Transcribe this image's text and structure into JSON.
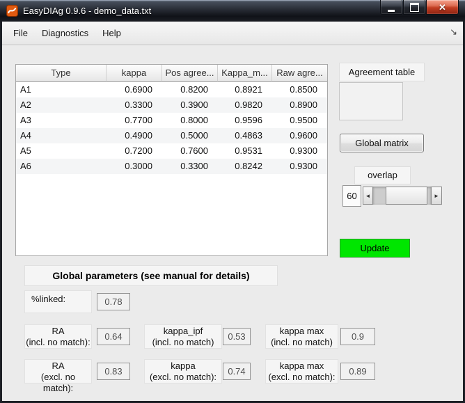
{
  "window": {
    "title": "EasyDIAg 0.9.6 - demo_data.txt"
  },
  "menu": {
    "items": [
      "File",
      "Diagnostics",
      "Help"
    ]
  },
  "icons": {
    "app": "matlab-logo",
    "minimize": "minimize-bar",
    "maximize": "restore-box",
    "close": "✕",
    "menubar_dock": "↘",
    "slider_left": "◄",
    "slider_right": "►"
  },
  "table": {
    "columns": [
      "Type",
      "kappa",
      "Pos agree...",
      "Kappa_m...",
      "Raw agre..."
    ],
    "rows": [
      [
        "A1",
        "0.6900",
        "0.8200",
        "0.8921",
        "0.8500"
      ],
      [
        "A2",
        "0.3300",
        "0.3900",
        "0.9820",
        "0.8900"
      ],
      [
        "A3",
        "0.7700",
        "0.8000",
        "0.9596",
        "0.9500"
      ],
      [
        "A4",
        "0.4900",
        "0.5000",
        "0.4863",
        "0.9600"
      ],
      [
        "A5",
        "0.7200",
        "0.7600",
        "0.9531",
        "0.9300"
      ],
      [
        "A6",
        "0.3000",
        "0.3300",
        "0.8242",
        "0.9300"
      ]
    ]
  },
  "side": {
    "agreement_table_label": "Agreement table",
    "global_matrix_label": "Global matrix",
    "overlap_label": "overlap",
    "overlap_value": "60",
    "update_label": "Update"
  },
  "colors": {
    "update_button": "#00e600",
    "close_button": "#c23d22"
  },
  "global_params": {
    "heading": "Global parameters (see manual for details)",
    "linked": {
      "label": "%linked:",
      "value": "0.78"
    },
    "ra_incl": {
      "line1": "RA",
      "line2": "(incl. no match):",
      "value": "0.64"
    },
    "kappa_ipf_incl": {
      "line1": "kappa_ipf",
      "line2": "(incl. no match)",
      "value": "0.53"
    },
    "kappa_max_incl": {
      "line1": "kappa max",
      "line2": "(incl. no match)",
      "value": "0.9"
    },
    "ra_excl": {
      "line1": "RA",
      "line2": "(excl. no match):",
      "value": "0.83"
    },
    "kappa_excl": {
      "line1": "kappa",
      "line2": "(excl. no match):",
      "value": "0.74"
    },
    "kappa_max_excl": {
      "line1": "kappa max",
      "line2": "(excl. no match):",
      "value": "0.89"
    }
  }
}
